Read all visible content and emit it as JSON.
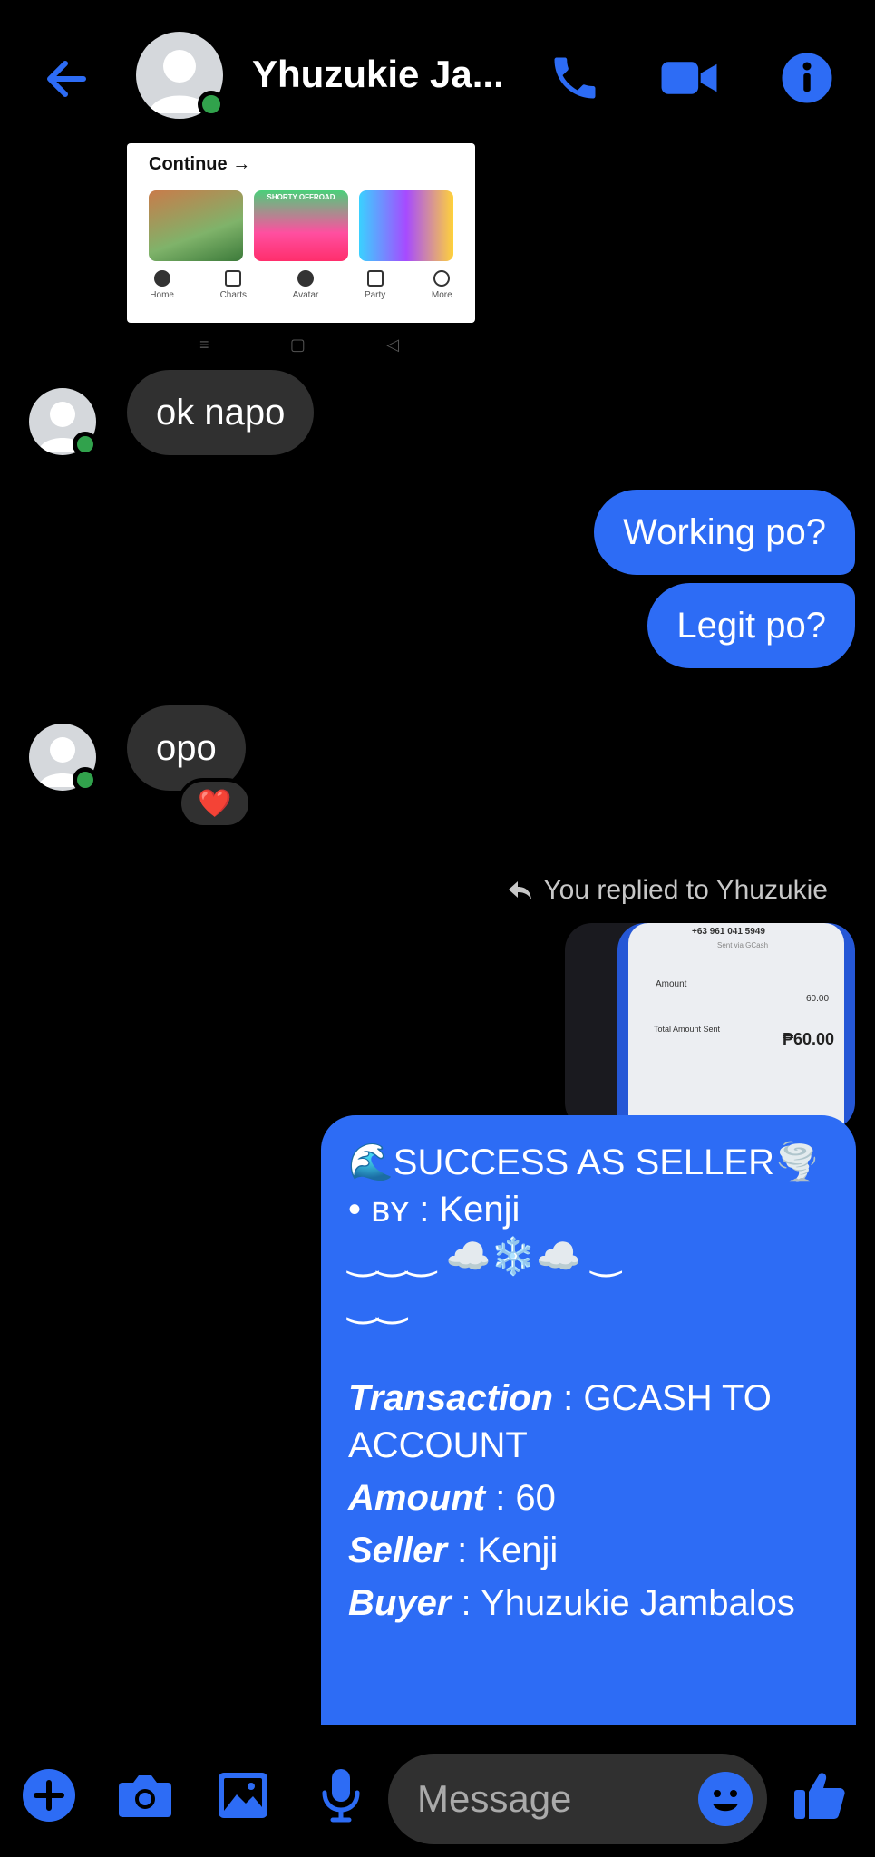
{
  "header": {
    "contact_name": "Yhuzukie Ja...",
    "accent": "#2d6cf5"
  },
  "shared_screenshot": {
    "title": "Continue →",
    "tile_banner": "SHORTY OFFROAD",
    "nav": [
      "Home",
      "Charts",
      "Avatar",
      "Party",
      "More"
    ]
  },
  "messages": [
    {
      "from": "them",
      "text": "ok napo"
    },
    {
      "from": "me",
      "text": "Working po?"
    },
    {
      "from": "me",
      "text": "Legit po?"
    },
    {
      "from": "them",
      "text": "opo",
      "reaction": "❤️"
    }
  ],
  "reply": {
    "label": "You replied to Yhuzukie",
    "image": {
      "number": "+63 961 041 5949",
      "sent_via": "Sent via GCash",
      "amount_label": "Amount",
      "amount_value": "60.00",
      "total_label": "Total Amount Sent",
      "total_value": "₱60.00"
    }
  },
  "receipt": {
    "title": "🌊SUCCESS AS SELLER🌪️",
    "by_line": "• ʙʏ : Kenji",
    "deco1": "‿‿‿ ☁️❄️☁️ ‿",
    "deco2": "‿‿",
    "transaction_label": "Transaction",
    "transaction_value": " : GCASH TO ACCOUNT",
    "amount_label": "Amount",
    "amount_value": " : 60",
    "seller_label": "Seller",
    "seller_value": " : Kenji",
    "buyer_label": "Buyer",
    "buyer_value": " : Yhuzukie Jambalos"
  },
  "composer": {
    "placeholder": "Message"
  }
}
